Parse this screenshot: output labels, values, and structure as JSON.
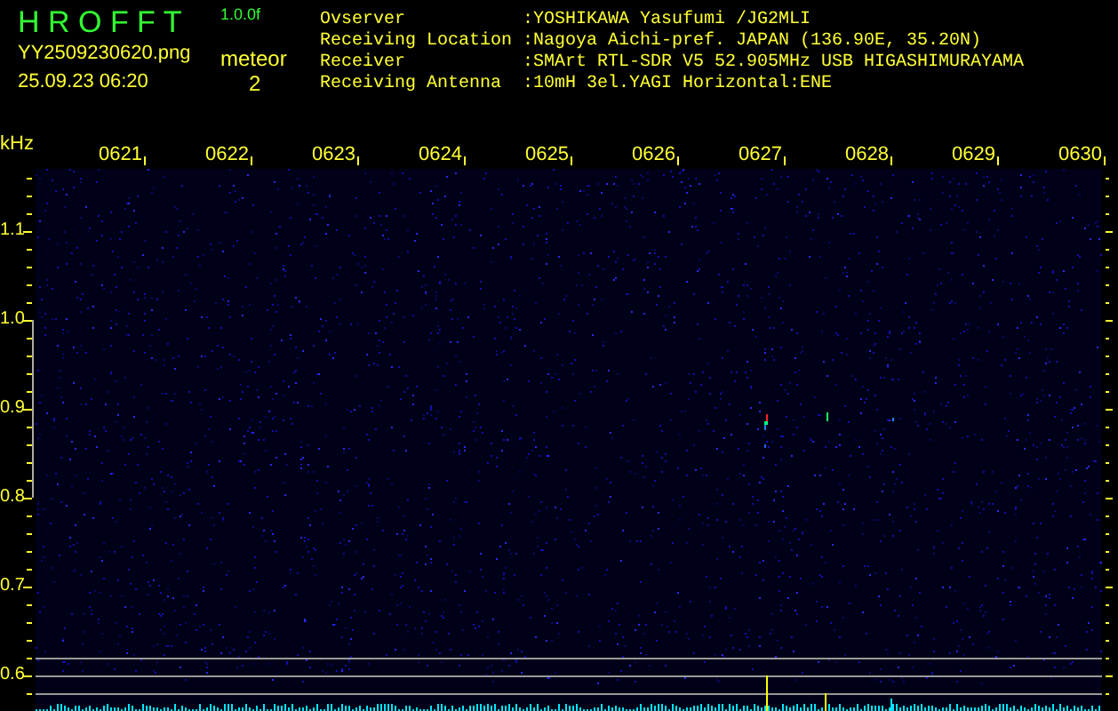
{
  "app": {
    "title": "H R O F F T",
    "version": "1.0.0f",
    "filename": "YY2509230620.png",
    "timestamp": "25.09.23 06:20",
    "meteor_label": "meteor",
    "meteor_count": "2"
  },
  "info": [
    {
      "label": "Ovserver",
      "value": ":YOSHIKAWA Yasufumi /JG2MLI"
    },
    {
      "label": "Receiving Location",
      "value": ":Nagoya Aichi-pref. JAPAN (136.90E, 35.20N)"
    },
    {
      "label": "Receiver",
      "value": ":SMArt RTL-SDR V5 52.905MHz USB HIGASHIMURAYAMA"
    },
    {
      "label": "Receiving Antenna",
      "value": ":10mH 3el.YAGI Horizontal:ENE"
    }
  ],
  "spectrogram": {
    "unit": "kHz",
    "time_labels": [
      "0621",
      "0622",
      "0623",
      "0624",
      "0625",
      "0626",
      "0627",
      "0628",
      "0629",
      "0630"
    ],
    "freq_labels": [
      "1.1",
      "1.0",
      "0.9",
      "0.8",
      "0.7",
      "0.6"
    ]
  }
}
